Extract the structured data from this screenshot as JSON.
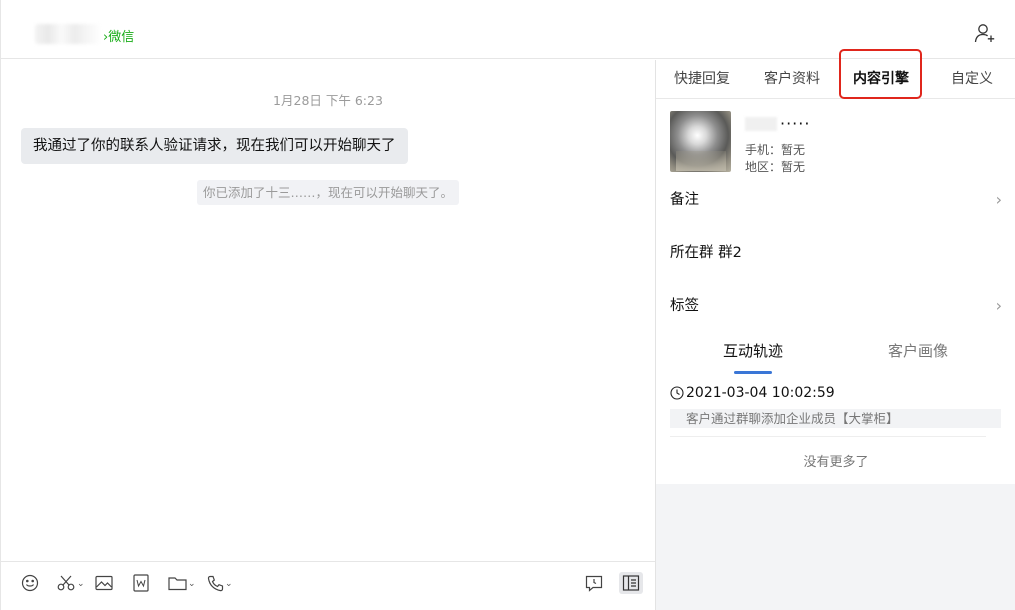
{
  "header": {
    "source_tag": "›微信",
    "icons": {
      "add_contact": "add-user-icon"
    }
  },
  "chat": {
    "timestamp": "1月28日 下午 6:23",
    "messages": [
      {
        "type": "bubble",
        "text": "我通过了你的联系人验证请求，现在我们可以开始聊天了"
      },
      {
        "type": "system",
        "text": "你已添加了十三……，现在可以开始聊天了。"
      }
    ]
  },
  "toolbar": {
    "icons": [
      "emoji-icon",
      "scissors-icon",
      "image-icon",
      "word-doc-icon",
      "folder-icon",
      "phone-icon",
      "chat-history-icon",
      "sidebar-toggle-icon"
    ]
  },
  "panel": {
    "tabs": [
      {
        "label": "快捷回复"
      },
      {
        "label": "客户资料"
      },
      {
        "label": "内容引擎",
        "selected": true
      },
      {
        "label": "自定义"
      }
    ],
    "customer": {
      "name_suffix": "·····",
      "phone": "手机：暂无",
      "region": "地区：暂无"
    },
    "rows": {
      "remark": "备注",
      "group": "所在群   群2",
      "tags": "标签"
    },
    "subtabs": [
      {
        "label": "互动轨迹",
        "active": true
      },
      {
        "label": "客户画像",
        "active": false
      }
    ],
    "trail": {
      "time": "2021-03-04 10:02:59",
      "description": "客户通过群聊添加企业成员【大掌柜】"
    },
    "no_more": "没有更多了"
  },
  "colors": {
    "wechat_green": "#1aad19",
    "highlight_red": "#e0261c",
    "accent_blue": "#3a76d6"
  }
}
